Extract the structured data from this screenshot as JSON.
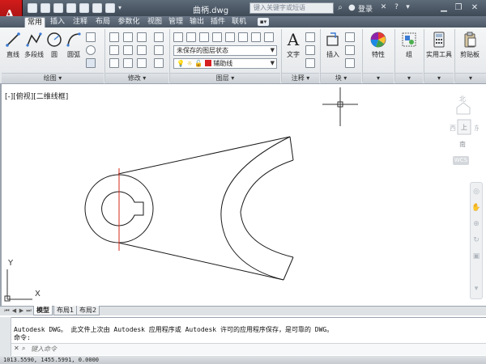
{
  "titlebar": {
    "doc_title": "曲柄.dwg",
    "search_placeholder": "键入关键字或短语",
    "login_label": "登录",
    "app_logo_letter": "A"
  },
  "tabs": [
    {
      "label": "常用",
      "active": true
    },
    {
      "label": "插入"
    },
    {
      "label": "注释"
    },
    {
      "label": "布局"
    },
    {
      "label": "参数化"
    },
    {
      "label": "视图"
    },
    {
      "label": "管理"
    },
    {
      "label": "输出"
    },
    {
      "label": "插件"
    },
    {
      "label": "联机"
    }
  ],
  "ribbon": {
    "draw_tools": [
      "直线",
      "多段线",
      "圆",
      "圆弧"
    ],
    "panels": {
      "draw": "绘图",
      "modify": "修改",
      "layers": "图层",
      "annotation": "注释",
      "block": "块"
    },
    "layer_state": "未保存的图层状态",
    "current_layer": "辅助线",
    "layer_color": "#d61f1f",
    "text_tool": "文字",
    "insert_tool": "插入",
    "properties_tool": "特性",
    "group_tool": "组",
    "utilities_tool": "实用工具",
    "clipboard_tool": "剪贴板"
  },
  "viewport": {
    "label": "[-][俯视][二维线框]",
    "viewcube_face": "上",
    "viewcube_south": "南",
    "wcs": "WCS",
    "ucs_x": "X",
    "ucs_y": "Y"
  },
  "layout_tabs": [
    {
      "label": "模型",
      "active": true
    },
    {
      "label": "布局1"
    },
    {
      "label": "布局2"
    }
  ],
  "command": {
    "history_line1": "Autodesk DWG。  此文件上次由  Autodesk 应用程序或  Autodesk 许可的应用程序保存，是可靠的 DWG。",
    "history_line2": "命令:",
    "input_placeholder": "键入命令"
  },
  "status": {
    "coords": "1013.5590,  1455.5991, 0.0000"
  },
  "colors": {
    "accent_red": "#d21b1b",
    "titlebar": "#4b5664",
    "centerline": "#d62a1a"
  }
}
